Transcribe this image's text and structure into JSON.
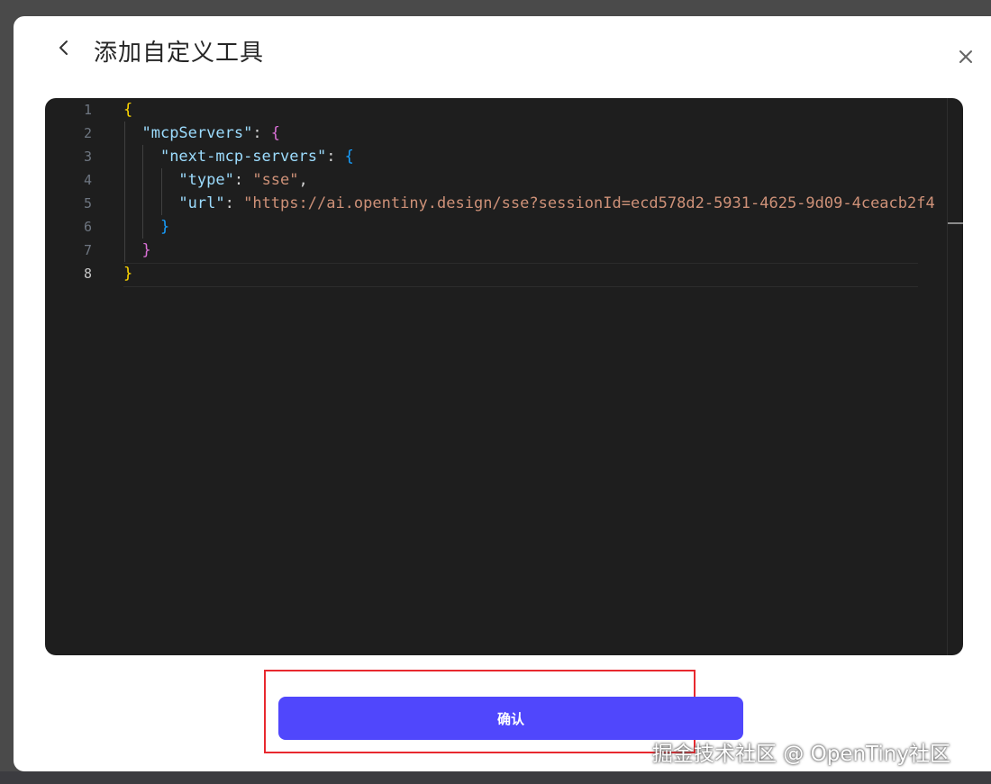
{
  "dialog": {
    "title": "添加自定义工具",
    "back_icon": "chevron-left-icon",
    "close_icon": "close-icon"
  },
  "editor": {
    "line_numbers": [
      "1",
      "2",
      "3",
      "4",
      "5",
      "6",
      "7",
      "8"
    ],
    "active_line": "8",
    "lines": [
      {
        "tokens": [
          {
            "t": "{",
            "c": "brace-y"
          }
        ]
      },
      {
        "tokens": [
          {
            "t": "  ",
            "c": "punct"
          },
          {
            "t": "\"mcpServers\"",
            "c": "key"
          },
          {
            "t": ": ",
            "c": "punct"
          },
          {
            "t": "{",
            "c": "brace-p"
          }
        ]
      },
      {
        "tokens": [
          {
            "t": "    ",
            "c": "punct"
          },
          {
            "t": "\"next-mcp-servers\"",
            "c": "key"
          },
          {
            "t": ": ",
            "c": "punct"
          },
          {
            "t": "{",
            "c": "brace-b"
          }
        ]
      },
      {
        "tokens": [
          {
            "t": "      ",
            "c": "punct"
          },
          {
            "t": "\"type\"",
            "c": "key"
          },
          {
            "t": ": ",
            "c": "punct"
          },
          {
            "t": "\"sse\"",
            "c": "str"
          },
          {
            "t": ",",
            "c": "punct"
          }
        ]
      },
      {
        "tokens": [
          {
            "t": "      ",
            "c": "punct"
          },
          {
            "t": "\"url\"",
            "c": "key"
          },
          {
            "t": ": ",
            "c": "punct"
          },
          {
            "t": "\"https://ai.opentiny.design/sse?sessionId=ecd578d2-5931-4625-9d09-4ceacb2f4",
            "c": "str"
          }
        ]
      },
      {
        "tokens": [
          {
            "t": "    ",
            "c": "punct"
          },
          {
            "t": "}",
            "c": "brace-b"
          }
        ]
      },
      {
        "tokens": [
          {
            "t": "  ",
            "c": "punct"
          },
          {
            "t": "}",
            "c": "brace-p"
          }
        ]
      },
      {
        "tokens": [
          {
            "t": "}",
            "c": "brace-y"
          }
        ]
      }
    ]
  },
  "footer": {
    "confirm_label": "确认"
  },
  "watermark": "掘金技术社区 @ OpenTiny社区",
  "colors": {
    "accent": "#5047fc",
    "highlight": "#e8292f",
    "editor_bg": "#1e1e1e"
  }
}
